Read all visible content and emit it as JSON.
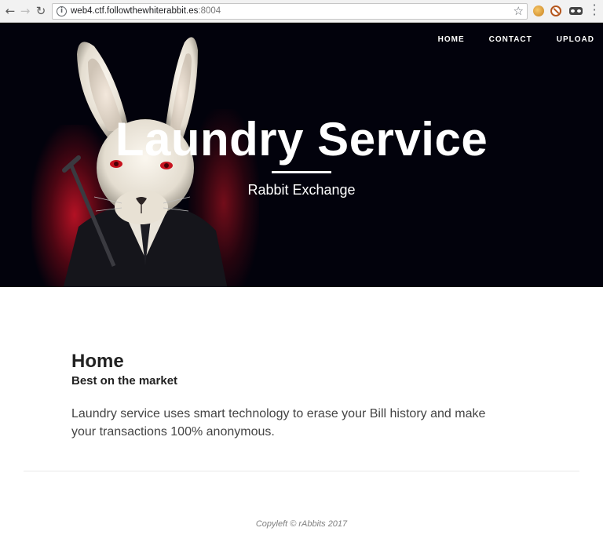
{
  "browser": {
    "url_host": "web4.ctf.followthewhiterabbit.es",
    "url_port": ":8004",
    "back_icon": "arrow-left-icon",
    "forward_icon": "arrow-right-icon",
    "reload_icon": "reload-icon",
    "info_icon": "info-icon",
    "star_icon": "star-icon",
    "menu_icon": "more-vert-icon"
  },
  "nav": {
    "items": [
      {
        "label": "HOME"
      },
      {
        "label": "CONTACT"
      },
      {
        "label": "UPLOAD"
      }
    ]
  },
  "hero": {
    "title": "Laundry Service",
    "subtitle": "Rabbit Exchange",
    "image": "white-rabbit-image",
    "accent_color": "#d3142a"
  },
  "main": {
    "heading": "Home",
    "subheading": "Best on the market",
    "body": "Laundry service uses smart technology to erase your Bill history and make your transactions 100% anonymous."
  },
  "footer": {
    "text": "Copyleft © rAbbits 2017"
  }
}
